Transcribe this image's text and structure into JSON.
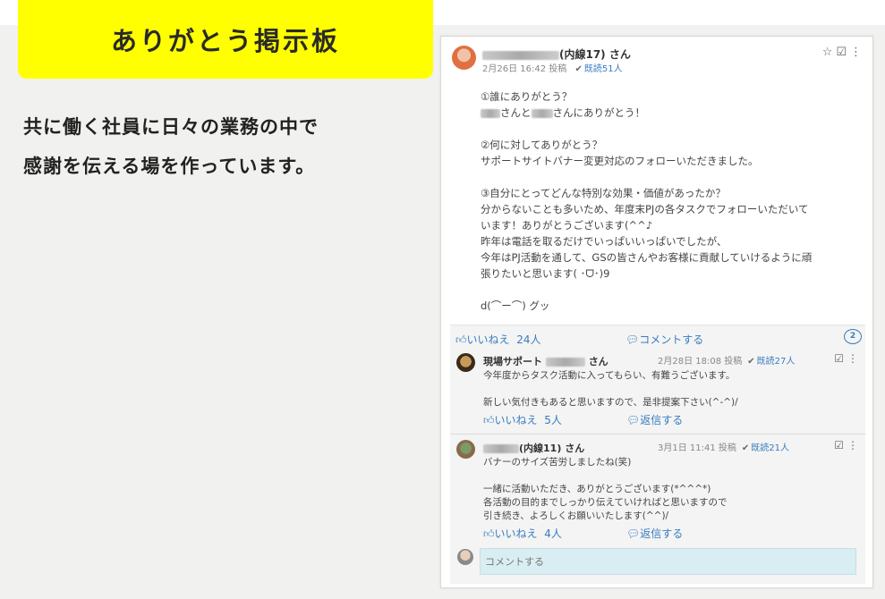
{
  "title": "ありがとう掲示板",
  "tagline": [
    "共に働く社員に日々の業務の中で",
    "感謝を伝える場を作っています。"
  ],
  "post": {
    "author_suffix": "(内線17) さん",
    "date": "2月26日 16:42 投稿",
    "read": "既読51人",
    "body": [
      "①誰にありがとう？",
      "さんと",
      "さんにありがとう！",
      "",
      "②何に対してありがとう？",
      "サポートサイトバナー変更対応のフォローいただきました。",
      "",
      "③自分にとってどんな特別な効果・価値があったか？",
      "分からないことも多いため、年度末PJの各タスクでフォローいただいて",
      "います！ありがとうございます(^^♪",
      "昨年は電話を取るだけでいっぱいいっぱいでしたが、",
      "今年はPJ活動を通して、GSの皆さんやお客様に貢献していけるように頑",
      "張りたいと思います( ･ᗜ･)9",
      "",
      "d(⌒ー⌒) グッ"
    ],
    "like_label": "いいねえ",
    "like_count": "24人",
    "comment_label": "コメントする",
    "comment_count": "2"
  },
  "comments": [
    {
      "author_prefix": "現場サポート",
      "author_suffix": "さん",
      "date": "2月28日 18:08 投稿",
      "read": "既読27人",
      "body": [
        "今年度からタスク活動に入ってもらい、有難うございます。",
        "",
        "新しい気付きもあると思いますので、是非提案下さい(^-^)/"
      ],
      "like_label": "いいねえ",
      "like_count": "5人",
      "reply_label": "返信する"
    },
    {
      "author_prefix": "",
      "author_suffix": "(内線11) さん",
      "date": "3月1日 11:41 投稿",
      "read": "既読21人",
      "body": [
        "バナーのサイズ苦労しましたね(笑)",
        "",
        "一緒に活動いただき、ありがとうございます(*^^^*)",
        "各活動の目的までしっかり伝えていければと思いますので",
        "引き続き、よろしくお願いいたします(^^)/"
      ],
      "like_label": "いいねえ",
      "like_count": "4人",
      "reply_label": "返信する"
    }
  ],
  "comment_input": {
    "placeholder": "コメントする"
  },
  "icons": {
    "star": "star-icon",
    "task": "task-check-icon",
    "menu": "more-vertical-icon",
    "thumb": "thumbs-up-icon",
    "bubble": "speech-bubble-icon"
  },
  "colors": {
    "accent": "#3a7cc2",
    "banner": "#ffff00",
    "input_bg": "#d9eef3"
  }
}
